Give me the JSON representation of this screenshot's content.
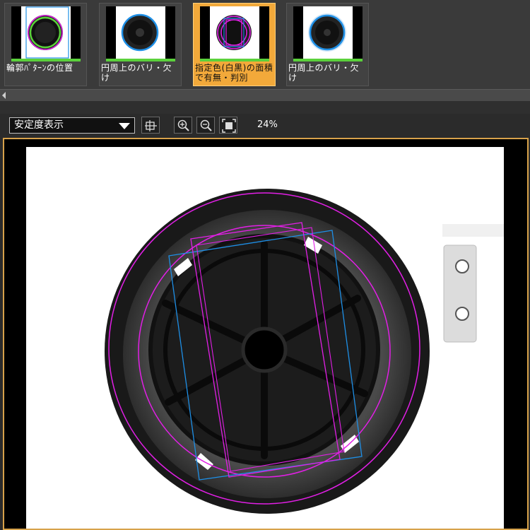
{
  "thumbnails": [
    {
      "label": "輪郭ﾊﾟﾀｰﾝの位置",
      "active": false
    },
    {
      "label": "円周上のバリ・欠け",
      "active": false
    },
    {
      "label": "指定色(白黒)の面積で有無・判別",
      "active": true
    },
    {
      "label": "円周上のバリ・欠け",
      "active": false
    }
  ],
  "toolbar": {
    "display_mode": "安定度表示",
    "zoom_level": "24%"
  },
  "colors": {
    "accent": "#f2a93a",
    "magenta": "#e21fe6",
    "blue": "#1e8fe6",
    "green": "#5bd13b"
  }
}
